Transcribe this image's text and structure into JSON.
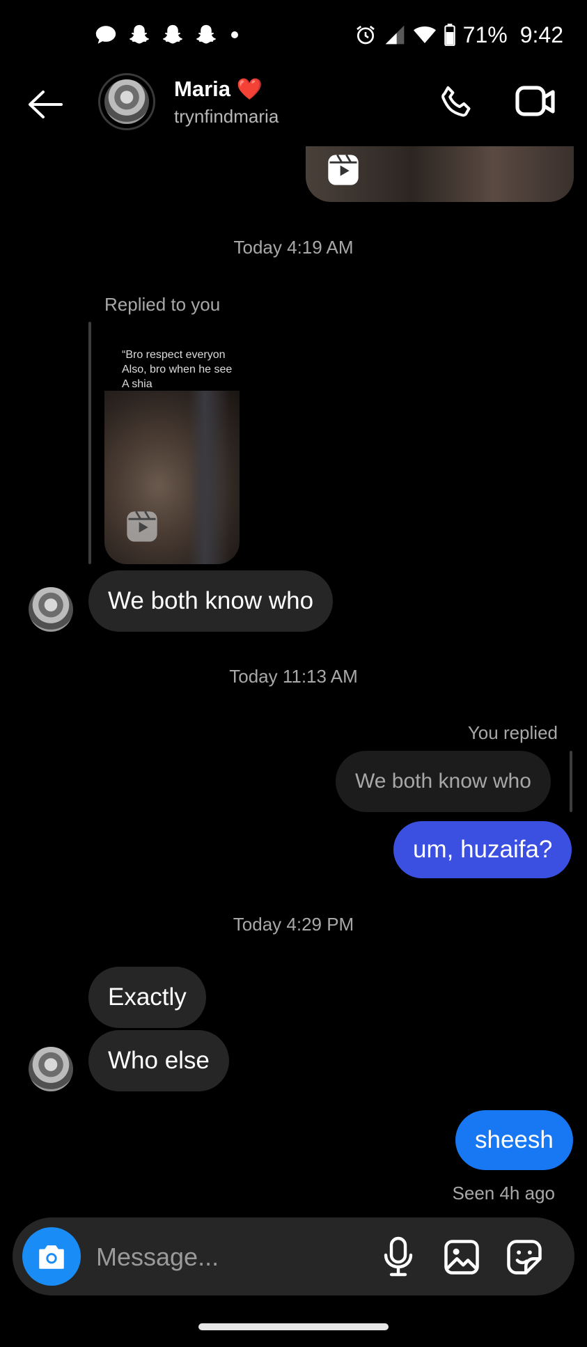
{
  "status_bar": {
    "battery": "71%",
    "time": "9:42",
    "icons_left": [
      "message-icon",
      "snapchat-icon",
      "snapchat-icon",
      "snapchat-icon",
      "dot-icon"
    ],
    "icons_right": [
      "alarm-icon",
      "signal-icon",
      "wifi-icon",
      "battery-icon"
    ]
  },
  "header": {
    "name": "Maria",
    "heart": "❤️",
    "username": "trynfindmaria",
    "icons": [
      "back-arrow-icon",
      "phone-icon",
      "video-icon"
    ]
  },
  "messages": {
    "divider1": "Today 4:19 AM",
    "replied_to_you": "Replied to you",
    "reel_caption": [
      "“Bro respect everyon",
      "Also, bro when he see",
      "A shia"
    ],
    "msg1": "We both know who",
    "divider2": "Today 11:13 AM",
    "you_replied": "You replied",
    "quoted": "We both know who",
    "msg2": "um, huzaifa?",
    "divider3": "Today 4:29 PM",
    "msg3": "Exactly",
    "msg4": "Who else",
    "msg5": "sheesh",
    "seen": "Seen 4h ago"
  },
  "composer": {
    "placeholder": "Message...",
    "icons": [
      "camera-icon",
      "microphone-icon",
      "gallery-icon",
      "sticker-icon"
    ]
  },
  "colors": {
    "background": "#000000",
    "bubble_received": "#262626",
    "bubble_sent_purple": "#3b4fe0",
    "bubble_sent_blue": "#1877f2",
    "camera_button": "#1a8cf6"
  }
}
